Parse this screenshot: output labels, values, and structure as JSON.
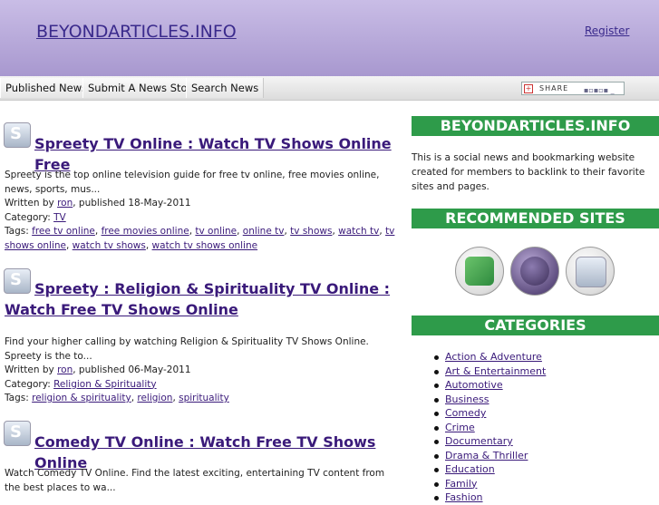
{
  "header": {
    "site_title": "BEYONDARTICLES.INFO",
    "register": "Register"
  },
  "nav": {
    "items": [
      "Published News",
      "Submit A News Story",
      "Search News"
    ]
  },
  "share": {
    "label": "SHARE"
  },
  "posts": [
    {
      "title": "Spreety TV Online : Watch TV Shows Online Free",
      "excerpt": "Spreety is the top online television guide for free tv online, free movies online, news, sports, mus...",
      "written_prefix": "Written by ",
      "author": "ron",
      "published": ", published 18-May-2011",
      "category_prefix": "Category: ",
      "category": "TV",
      "tags_prefix": "Tags: ",
      "tags": [
        "free tv online",
        "free movies online",
        "tv online",
        "online tv",
        "tv shows",
        "watch tv",
        "tv shows online",
        "watch tv shows",
        "watch tv shows online"
      ]
    },
    {
      "title": "Spreety : Religion & Spirituality TV Online : Watch Free TV Shows Online",
      "excerpt": "Find your higher calling by watching Religion & Spirituality TV Shows Online. Spreety is the to...",
      "written_prefix": "Written by ",
      "author": "ron",
      "published": ", published 06-May-2011",
      "category_prefix": "Category: ",
      "category": "Religion & Spirituality",
      "tags_prefix": "Tags: ",
      "tags": [
        "religion & spirituality",
        "religion",
        "spirituality"
      ]
    },
    {
      "title": "Comedy TV Online : Watch Free TV Shows Online",
      "excerpt": "Watch Comedy TV Online. Find the latest exciting, entertaining TV content from the best places to wa..."
    }
  ],
  "sidebar": {
    "site_heading": "BEYONDARTICLES.INFO",
    "description": "This is a social news and bookmarking website created for members to backlink to their favorite sites and pages.",
    "recommended_heading": "RECOMMENDED SITES",
    "categories_heading": "CATEGORIES",
    "categories": [
      "Action & Adventure",
      "Art & Entertainment",
      "Automotive",
      "Business",
      "Comedy",
      "Crime",
      "Documentary",
      "Drama & Thriller",
      "Education",
      "Family",
      "Fashion"
    ]
  },
  "colors": {
    "header": "#b3a5d9",
    "link": "#3a1a7a",
    "sidebar_bar": "#2e9b4a"
  }
}
